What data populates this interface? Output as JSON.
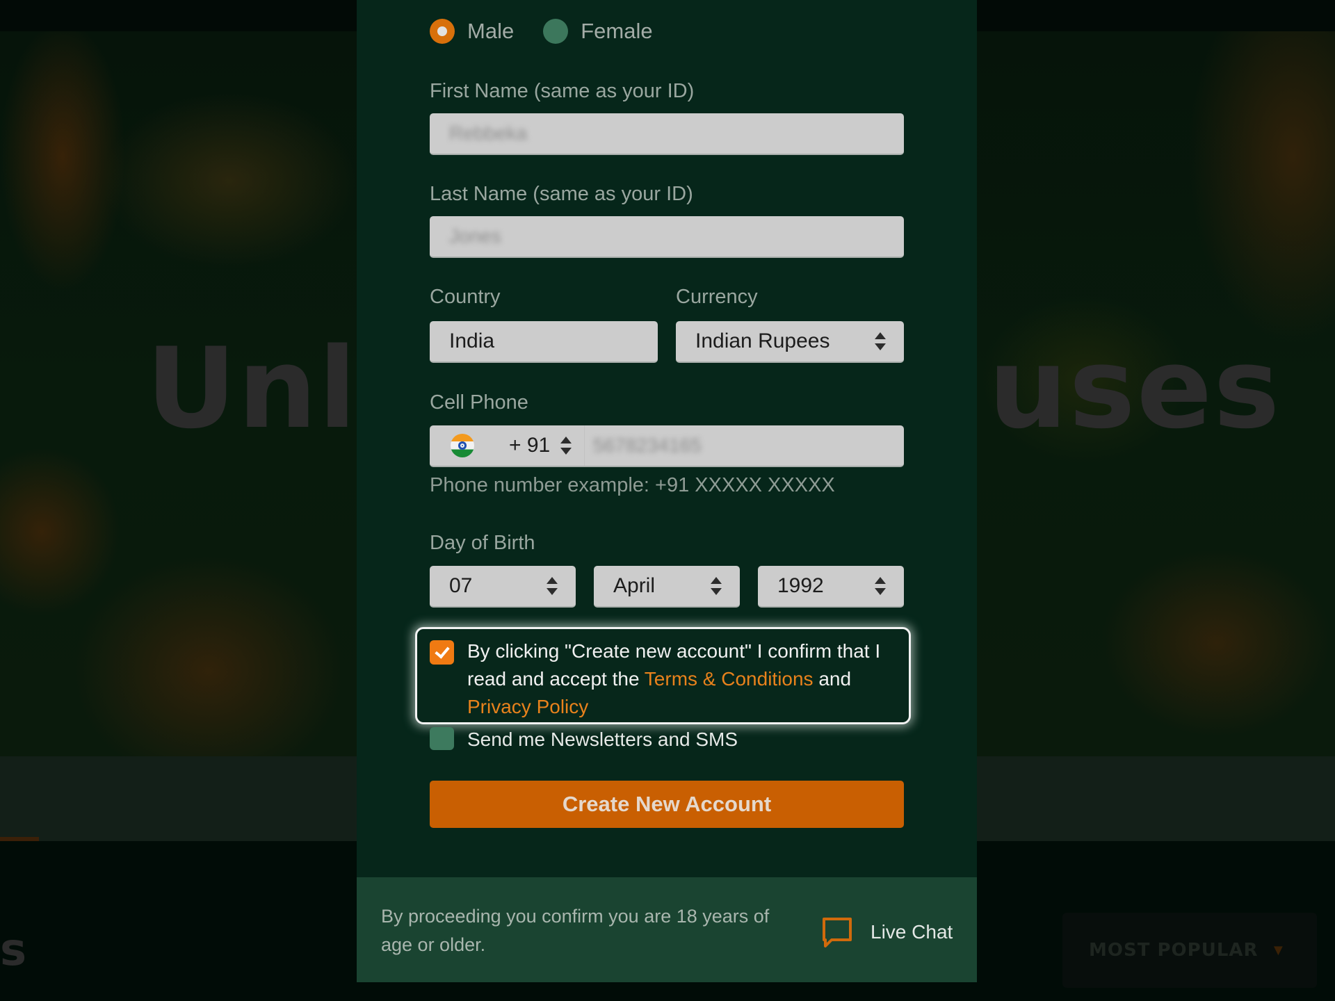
{
  "background": {
    "hero_title_left": "Unli",
    "hero_title_right": "uses",
    "section_title_fragment": "s",
    "sort_dropdown": {
      "label": "MOST POPULAR"
    }
  },
  "form": {
    "gender": {
      "options": [
        {
          "label": "Male",
          "selected": true
        },
        {
          "label": "Female",
          "selected": false
        }
      ]
    },
    "first_name": {
      "label": "First Name (same as your ID)",
      "value": "Rebbeka"
    },
    "last_name": {
      "label": "Last Name (same as your ID)",
      "value": "Jones"
    },
    "country": {
      "label": "Country",
      "value": "India"
    },
    "currency": {
      "label": "Currency",
      "value": "Indian Rupees"
    },
    "cell_phone": {
      "label": "Cell Phone",
      "country_code": "+ 91",
      "flag": "india-flag-icon",
      "value": "5678234165",
      "hint": "Phone number example: +91 XXXXX XXXXX"
    },
    "birth": {
      "label": "Day of Birth",
      "day": "07",
      "month": "April",
      "year": "1992"
    },
    "terms": {
      "checked": true,
      "text_before": "By clicking \"Create new account\" I confirm that I read and accept the ",
      "terms_link": "Terms & Conditions",
      "text_middle": " and ",
      "privacy_link": "Privacy Policy"
    },
    "newsletter": {
      "checked": false,
      "label": "Send me Newsletters and SMS"
    },
    "submit_label": "Create New Account"
  },
  "footer": {
    "age_note": "By proceeding you confirm you are 18 years of age or older.",
    "live_chat_label": "Live Chat"
  },
  "colors": {
    "accent": "#c95f02",
    "link": "#e8821c",
    "panel_bg": "#06261a",
    "footer_bg": "#1a4431"
  }
}
